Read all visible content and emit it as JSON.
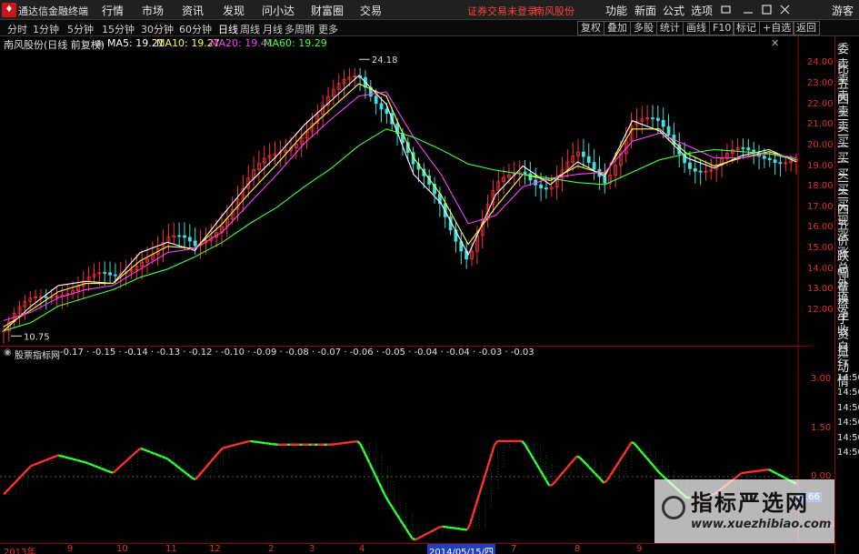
{
  "menubar": {
    "app_name": "通达信金融终端",
    "items": [
      "行情",
      "市场",
      "资讯",
      "发现",
      "问小达",
      "财富圈",
      "交易"
    ],
    "notice": "证券交易未登录",
    "stock_name": "南风股份",
    "right_items": [
      "功能",
      "新面",
      "公式",
      "选项"
    ],
    "guest": "游客"
  },
  "toolbar": {
    "periods": [
      "分时",
      "1分钟",
      "5分钟",
      "15分钟",
      "30分钟",
      "60分钟",
      "日线",
      "周线",
      "月线",
      "多周期",
      "更多"
    ],
    "active_period": "日线",
    "right_buttons": [
      "复权",
      "叠加",
      "多股",
      "统计",
      "画线",
      "F10",
      "标记",
      "+自选",
      "返回"
    ]
  },
  "infobar": {
    "title": "南风股份(日线 前复权)",
    "ma5": "MA5: 19.21",
    "ma10": "MA10: 19.27",
    "ma20": "MA20: 19.41",
    "ma60": "MA60: 19.29",
    "colors": {
      "ma5": "#ffffff",
      "ma10": "#ffff40",
      "ma20": "#ff40ff",
      "ma60": "#40ff40"
    }
  },
  "right_panel": [
    "委比",
    "卖五",
    "卖四",
    "卖三",
    "卖二",
    "卖一",
    "买一",
    "买二",
    "买三",
    "买四",
    "买五",
    "现价",
    "涨跌",
    "涨幅",
    "总量",
    "外盘",
    "换手",
    "净资",
    "收益",
    "自动",
    "行情",
    "14:50",
    "14:50",
    "14:50",
    "14:50",
    "14:50",
    "14:50"
  ],
  "price_axis": [
    "24.00",
    "23.00",
    "22.00",
    "21.00",
    "20.00",
    "19.00",
    "18.00",
    "17.00",
    "16.00",
    "15.00",
    "14.00",
    "13.00",
    "12.00"
  ],
  "price_marks": {
    "high": "24.18",
    "low": "10.75"
  },
  "indicator": {
    "name": "股票指标网",
    "values": [
      "-0.17",
      "-0.15",
      "-0.14",
      "-0.13",
      "-0.12",
      "-0.10",
      "-0.09",
      "-0.08",
      "-0.07",
      "-0.06",
      "-0.05",
      "-0.04",
      "-0.04",
      "-0.03",
      "-0.03"
    ],
    "axis": [
      "3.00",
      "1.50",
      "0.00",
      "-1.50"
    ],
    "current": "-0.66"
  },
  "x_axis": {
    "labels": [
      "2013年",
      "9",
      "10",
      "11",
      "12",
      "2",
      "3",
      "4",
      "2014/05/15/四",
      "7",
      "8",
      "9"
    ],
    "highlight": "2014/05/15/四"
  },
  "watermark": {
    "title": "指标严选网",
    "url": "www.xuezhibiao.com"
  },
  "chart_data": {
    "type": "line",
    "series": [
      {
        "name": "MA5",
        "values": [
          11.0,
          12.2,
          13.2,
          13.4,
          13.3,
          14.8,
          15.3,
          14.9,
          16.6,
          18.2,
          19.5,
          21.0,
          22.2,
          23.4,
          22.0,
          18.6,
          17.2,
          14.7,
          17.6,
          19.0,
          18.1,
          19.2,
          18.5,
          21.2,
          20.7,
          19.4,
          18.9,
          19.5,
          19.8,
          19.2
        ]
      },
      {
        "name": "MA10",
        "values": [
          11.2,
          12.0,
          12.9,
          13.3,
          13.3,
          14.4,
          15.1,
          15.0,
          16.2,
          17.7,
          19.1,
          20.6,
          21.8,
          23.0,
          22.4,
          19.4,
          17.6,
          15.2,
          17.0,
          18.6,
          18.3,
          19.0,
          18.6,
          20.8,
          20.8,
          19.6,
          19.0,
          19.4,
          19.7,
          19.3
        ]
      },
      {
        "name": "MA20",
        "values": [
          11.5,
          11.9,
          12.6,
          13.0,
          13.2,
          14.0,
          14.8,
          15.0,
          15.8,
          17.2,
          18.6,
          20.1,
          21.3,
          22.4,
          22.6,
          20.4,
          18.6,
          16.2,
          16.6,
          18.0,
          18.4,
          18.6,
          18.7,
          20.2,
          20.6,
          20.0,
          19.4,
          19.4,
          19.6,
          19.4
        ]
      },
      {
        "name": "MA60",
        "values": [
          11.0,
          11.4,
          12.2,
          12.6,
          13.0,
          13.6,
          14.0,
          14.6,
          15.3,
          16.2,
          17.0,
          18.0,
          18.9,
          20.0,
          20.8,
          20.4,
          19.8,
          19.1,
          18.8,
          18.6,
          18.4,
          18.2,
          18.1,
          18.7,
          19.3,
          19.6,
          19.8,
          19.7,
          19.6,
          19.3
        ]
      }
    ],
    "indicator_values": [
      -0.17,
      -0.15,
      -0.14,
      -0.13,
      -0.12,
      -0.1,
      -0.09,
      -0.08,
      -0.07,
      -0.06,
      -0.05,
      -0.04,
      -0.04,
      -0.03,
      -0.03
    ],
    "ylim": [
      10.5,
      24.5
    ],
    "indicator_ylim": [
      -2.0,
      3.6
    ]
  }
}
